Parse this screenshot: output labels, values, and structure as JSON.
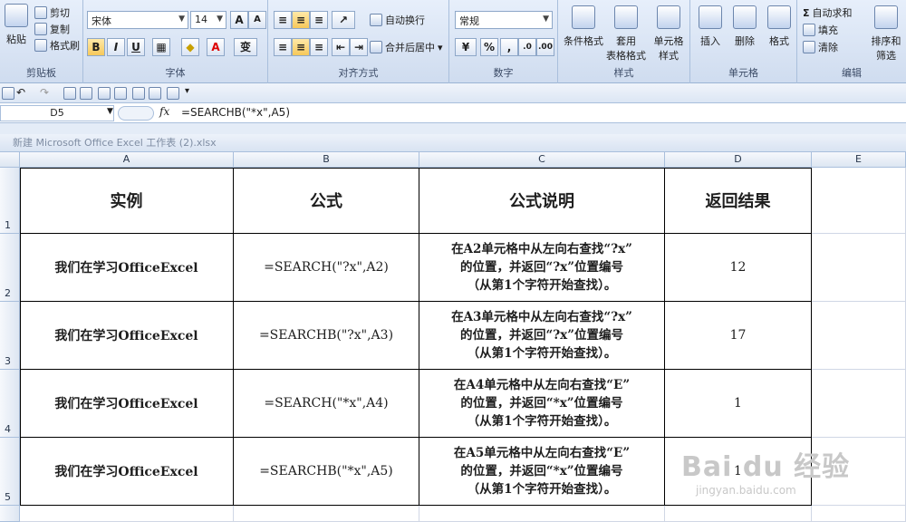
{
  "ribbon": {
    "clipboard": {
      "label": "剪贴板",
      "paste": "粘贴",
      "cut": "剪切",
      "copy": "复制",
      "format_painter": "格式刷"
    },
    "font": {
      "label": "字体",
      "name": "宋体",
      "size": "14",
      "bold": "B",
      "italic": "I",
      "underline": "U",
      "wen": "变"
    },
    "alignment": {
      "label": "对齐方式",
      "wrap": "自动换行",
      "merge": "合并后居中"
    },
    "number": {
      "label": "数字",
      "format": "常规",
      "percent": "%"
    },
    "styles": {
      "label": "样式",
      "conditional": "条件格式",
      "table_format": "套用\n表格格式",
      "cell_style": "单元格\n样式"
    },
    "cells": {
      "label": "单元格",
      "insert": "插入",
      "delete": "删除",
      "format": "格式"
    },
    "editing": {
      "label": "编辑",
      "autosum": "自动求和",
      "fill": "填充",
      "clear": "清除",
      "sort_filter": "排序和\n筛选"
    }
  },
  "formula_bar": {
    "name_box": "D5",
    "fx": "fx",
    "formula": "=SEARCHB(\"*x\",A5)"
  },
  "window_title": "新建 Microsoft Office Excel 工作表 (2).xlsx",
  "columns": [
    "A",
    "B",
    "C",
    "D",
    "E"
  ],
  "rows": [
    "1",
    "2",
    "3",
    "4",
    "5"
  ],
  "table": {
    "headers": [
      "实例",
      "公式",
      "公式说明",
      "返回结果"
    ],
    "rows": [
      {
        "example": "我们在学习OfficeExcel",
        "formula": "=SEARCH(\"?x\",A2)",
        "desc": [
          "在A2单元格中从左向右查找“?x”",
          "的位置，并返回“?x”位置编号",
          "（从第1个字符开始查找）。"
        ],
        "result": "12"
      },
      {
        "example": "我们在学习OfficeExcel",
        "formula": "=SEARCHB(\"?x\",A3)",
        "desc": [
          "在A3单元格中从左向右查找“?x”",
          "的位置，并返回“?x”位置编号",
          "（从第1个字符开始查找）。"
        ],
        "result": "17"
      },
      {
        "example": "我们在学习OfficeExcel",
        "formula": "=SEARCH(\"*x\",A4)",
        "desc": [
          "在A4单元格中从左向右查找“E”",
          "的位置，并返回“*x”位置编号",
          "（从第1个字符开始查找）。"
        ],
        "result": "1"
      },
      {
        "example": "我们在学习OfficeExcel",
        "formula": "=SEARCHB(\"*x\",A5)",
        "desc": [
          "在A5单元格中从左向右查找“E”",
          "的位置，并返回“*x”位置编号",
          "（从第1个字符开始查找）。"
        ],
        "result": "1"
      }
    ]
  },
  "watermark": {
    "brand": "Bai du 经验",
    "url": "jingyan.baidu.com"
  }
}
